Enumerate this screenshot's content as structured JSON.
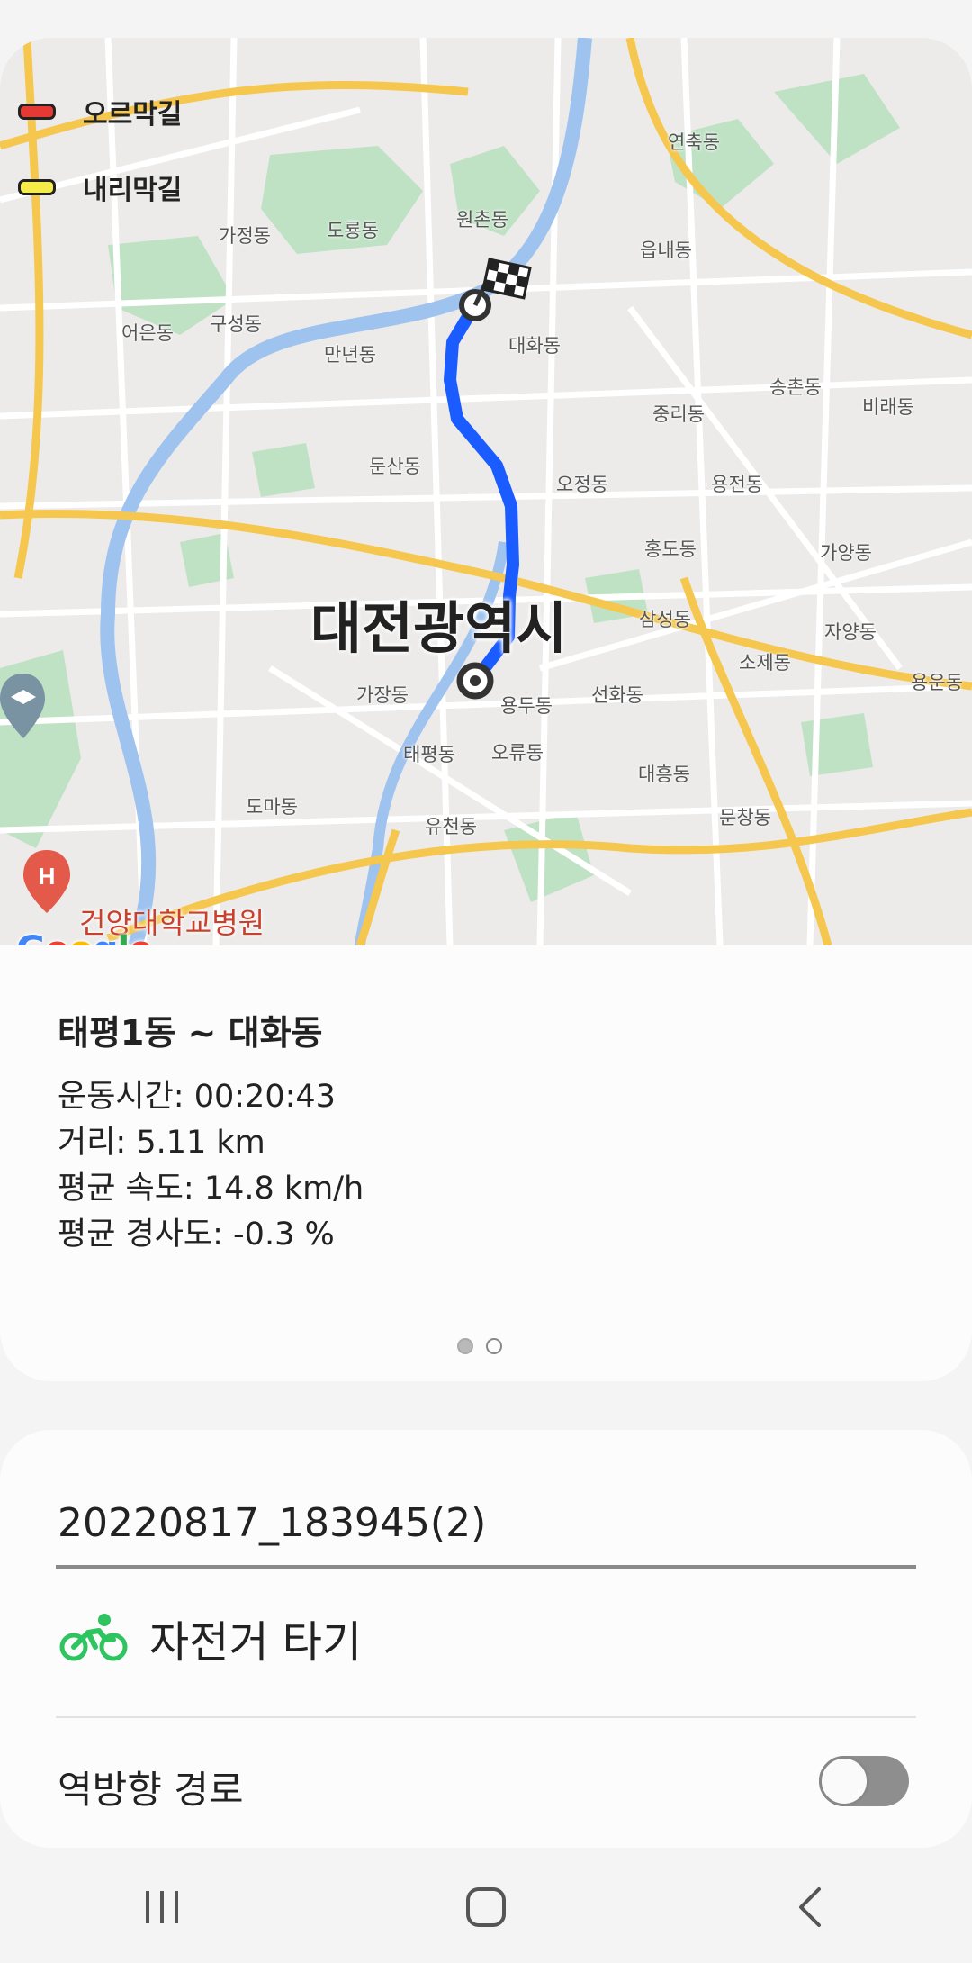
{
  "map": {
    "legend": [
      {
        "label": "오르막길",
        "color": "#e53935"
      },
      {
        "label": "내리막길",
        "color": "#f5ec4a"
      }
    ],
    "city_label": "대전광역시",
    "dong_labels": [
      {
        "text": "연축동"
      },
      {
        "text": "가정동"
      },
      {
        "text": "도룡동"
      },
      {
        "text": "원촌동"
      },
      {
        "text": "읍내동"
      },
      {
        "text": "어은동"
      },
      {
        "text": "구성동"
      },
      {
        "text": "만년동"
      },
      {
        "text": "대화동"
      },
      {
        "text": "송촌동"
      },
      {
        "text": "비래동"
      },
      {
        "text": "중리동"
      },
      {
        "text": "둔산동"
      },
      {
        "text": "오정동"
      },
      {
        "text": "용전동"
      },
      {
        "text": "홍도동"
      },
      {
        "text": "가양동"
      },
      {
        "text": "삼성동"
      },
      {
        "text": "자양동"
      },
      {
        "text": "소제동"
      },
      {
        "text": "용운동"
      },
      {
        "text": "가장동"
      },
      {
        "text": "용두동"
      },
      {
        "text": "선화동"
      },
      {
        "text": "태평동"
      },
      {
        "text": "오류동"
      },
      {
        "text": "대흥동"
      },
      {
        "text": "도마동"
      },
      {
        "text": "유천동"
      },
      {
        "text": "문창동"
      }
    ],
    "poi_label": "건양대학교병원",
    "google_logo": "Google",
    "route_color": "#1a5cff",
    "start_marker": "start-marker",
    "finish_marker": "finish-flag"
  },
  "summary": {
    "title": "태평1동 ~ 대화동",
    "duration": "운동시간: 00:20:43",
    "distance": "거리: 5.11 km",
    "avg_speed": "평균 속도: 14.8 km/h",
    "avg_slope": "평균 경사도: -0.3 %",
    "page_count": 2,
    "current_page": 1
  },
  "record": {
    "name": "20220817_183945(2)",
    "activity_icon": "bicycle-icon",
    "activity_label": "자전거 타기",
    "activity_color": "#2ec45f",
    "reverse_route_label": "역방향 경로",
    "reverse_route_enabled": false
  },
  "navbar": {
    "recent_icon": "recent-apps-icon",
    "home_icon": "home-icon",
    "back_icon": "back-icon"
  }
}
